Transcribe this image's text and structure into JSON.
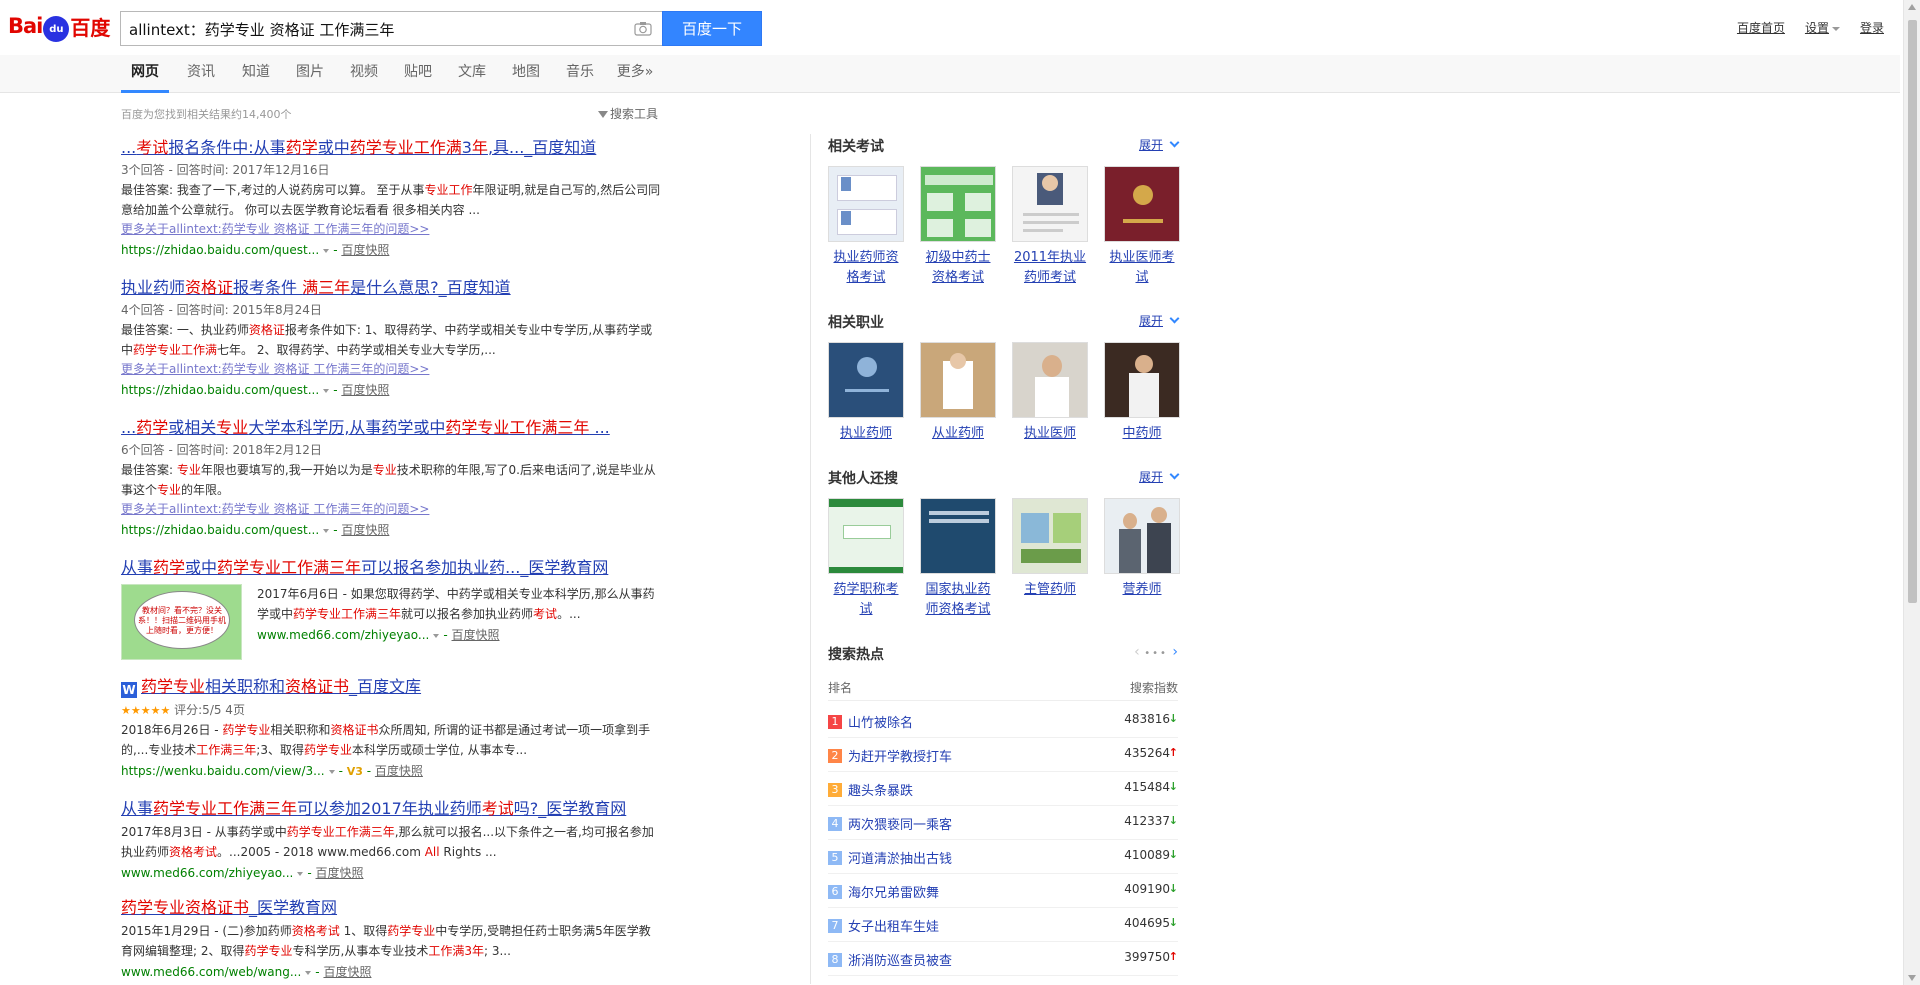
{
  "logo": {
    "part1": "Bai",
    "paw": "du",
    "part2": "百度"
  },
  "search": {
    "query": "allintext：药学专业 资格证 工作满三年",
    "button": "百度一下"
  },
  "user_links": {
    "home": "百度首页",
    "settings": "设置",
    "login": "登录"
  },
  "tabs": [
    "网页",
    "资讯",
    "知道",
    "图片",
    "视频",
    "贴吧",
    "文库",
    "地图",
    "音乐",
    "更多»"
  ],
  "result_count": "百度为您找到相关结果约14,400个",
  "search_tools": "搜索工具",
  "results": [
    {
      "title": [
        [
          "...",
          false
        ],
        [
          "考试",
          true
        ],
        [
          "报名条件中:从事",
          false
        ],
        [
          "药学",
          true
        ],
        [
          "或中",
          false
        ],
        [
          "药学专业工作满",
          true
        ],
        [
          "3",
          false
        ],
        [
          "年",
          true
        ],
        [
          ",具..._百度知道",
          false
        ]
      ],
      "meta": "3个回答 - 回答时间: 2017年12月16日",
      "abstract": [
        [
          "最佳答案: 我查了一下,考过的人说药房可以算。 至于从事",
          false
        ],
        [
          "专业工作",
          true
        ],
        [
          "年限证明,就是自己写的,然后公司同意给加盖个公章就行。 你可以去医学教育论坛看看 很多相关内容 ...",
          false
        ]
      ],
      "more": "更多关于allintext:药学专业 资格证 工作满三年的问题>>",
      "url": "https://zhidao.baidu.com/quest...",
      "cache": "百度快照"
    },
    {
      "title": [
        [
          "执业药师",
          false
        ],
        [
          "资格证",
          true
        ],
        [
          "报考条件 ",
          false
        ],
        [
          "满三年",
          true
        ],
        [
          "是什么意思?_百度知道",
          false
        ]
      ],
      "meta": "4个回答 - 回答时间: 2015年8月24日",
      "abstract": [
        [
          "最佳答案: 一、执业药师",
          false
        ],
        [
          "资格证",
          true
        ],
        [
          "报考条件如下: 1、取得药学、中药学或相关专业中专学历,从事药学或中",
          false
        ],
        [
          "药学专业工作满",
          true
        ],
        [
          "七年。 2、取得药学、中药学或相关专业大专学历,...",
          false
        ]
      ],
      "more": "更多关于allintext:药学专业 资格证 工作满三年的问题>>",
      "url": "https://zhidao.baidu.com/quest...",
      "cache": "百度快照"
    },
    {
      "title": [
        [
          "...",
          false
        ],
        [
          "药学",
          true
        ],
        [
          "或相关",
          false
        ],
        [
          "专业",
          true
        ],
        [
          "大学本科学历,从事药学或中",
          false
        ],
        [
          "药学专业工作满三年",
          true
        ],
        [
          " ...",
          false
        ]
      ],
      "meta": "6个回答 - 回答时间: 2018年2月12日",
      "abstract": [
        [
          "最佳答案: ",
          false
        ],
        [
          "专业",
          true
        ],
        [
          "年限也要填写的,我一开始以为是",
          false
        ],
        [
          "专业",
          true
        ],
        [
          "技术职称的年限,写了0.后来电话问了,说是毕业从事这个",
          false
        ],
        [
          "专业",
          true
        ],
        [
          "的年限。",
          false
        ]
      ],
      "more": "更多关于allintext:药学专业 资格证 工作满三年的问题>>",
      "url": "https://zhidao.baidu.com/quest...",
      "cache": "百度快照"
    },
    {
      "title": [
        [
          "从事",
          false
        ],
        [
          "药学",
          true
        ],
        [
          "或中",
          false
        ],
        [
          "药学专业工作满三年",
          true
        ],
        [
          "可以报名参加执业药..._医学教育网",
          false
        ]
      ],
      "thumb_text": "教材间？看不完？没关系！！扫描二维码用手机上随时看，更方便！",
      "abstract": [
        [
          "2017年6月6日 - 如果您取得药学、中药学或相关专业本科学历,那么从事药学或中",
          false
        ],
        [
          "药学专业工作满三年",
          true
        ],
        [
          "就可以报名参加执业药师",
          false
        ],
        [
          "考试",
          true
        ],
        [
          "。...",
          false
        ]
      ],
      "url": "www.med66.com/zhiyeyao...",
      "cache": "百度快照"
    },
    {
      "title": [
        [
          "药学专业",
          true
        ],
        [
          "相关职称和",
          false
        ],
        [
          "资格证书",
          true
        ],
        [
          "_百度文库",
          false
        ]
      ],
      "doc_icon": "W",
      "rating": "★★★★★",
      "rating_text": "评分:5/5 4页",
      "abstract": [
        [
          "2018年6月26日 - ",
          false
        ],
        [
          "药学专业",
          true
        ],
        [
          "相关职称和",
          false
        ],
        [
          "资格证书",
          true
        ],
        [
          "众所周知, 所谓的证书都是通过考试一项一项拿到手的,...专业技术",
          false
        ],
        [
          "工作满三年",
          true
        ],
        [
          ";3、取得",
          false
        ],
        [
          "药学专业",
          true
        ],
        [
          "本科学历或硕士学位, 从事本专...",
          false
        ]
      ],
      "url": "https://wenku.baidu.com/view/3...",
      "v_badge": "V3",
      "cache": "百度快照"
    },
    {
      "title": [
        [
          "从事",
          false
        ],
        [
          "药学专业工作满三年",
          true
        ],
        [
          "可以参加2017年执业药师",
          false
        ],
        [
          "考试",
          true
        ],
        [
          "吗?_医学教育网",
          false
        ]
      ],
      "abstract": [
        [
          "2017年8月3日 - 从事药学或中",
          false
        ],
        [
          "药学专业工作满三年",
          true
        ],
        [
          ",那么就可以报名...以下条件之一者,均可报名参加执业药师",
          false
        ],
        [
          "资格考试",
          true
        ],
        [
          "。...2005 - 2018 www.med66.com ",
          false
        ],
        [
          "All",
          true
        ],
        [
          " Rights ...",
          false
        ]
      ],
      "url": "www.med66.com/zhiyeyao...",
      "cache": "百度快照"
    },
    {
      "title": [
        [
          "药学专业资格证书",
          true
        ],
        [
          "_医学教育网",
          false
        ]
      ],
      "abstract": [
        [
          "2015年1月29日 - (二)参加药师",
          false
        ],
        [
          "资格考试",
          true
        ],
        [
          " 1、取得",
          false
        ],
        [
          "药学专业",
          true
        ],
        [
          "中专学历,受聘担任药士职务满5年医学教育网编辑整理; 2、取得",
          false
        ],
        [
          "药学专业",
          true
        ],
        [
          "专科学历,从事本专业技术",
          false
        ],
        [
          "工作满3年",
          true
        ],
        [
          "; 3...",
          false
        ]
      ],
      "url": "www.med66.com/web/wang...",
      "cache": "百度快照"
    }
  ],
  "sidebar": {
    "expand": "展开",
    "related_exams": {
      "title": "相关考试",
      "items": [
        "执业药师资格考试",
        "初级中药士资格考试",
        "2011年执业药师考试",
        "执业医师考试"
      ]
    },
    "related_jobs": {
      "title": "相关职业",
      "items": [
        "执业药师",
        "从业药师",
        "执业医师",
        "中药师"
      ]
    },
    "others_search": {
      "title": "其他人还搜",
      "items": [
        "药学职称考试",
        "国家执业药师资格考试",
        "主管药师",
        "营养师"
      ]
    },
    "hot": {
      "title": "搜索热点",
      "col_rank": "排名",
      "col_index": "搜索指数",
      "rows": [
        {
          "rank": "1",
          "word": "山竹被除名",
          "index": "483816",
          "trend": "down"
        },
        {
          "rank": "2",
          "word": "为赶开学教授打车",
          "index": "435264",
          "trend": "up"
        },
        {
          "rank": "3",
          "word": "趣头条暴跌",
          "index": "415484",
          "trend": "down"
        },
        {
          "rank": "4",
          "word": "两次猥亵同一乘客",
          "index": "412337",
          "trend": "down"
        },
        {
          "rank": "5",
          "word": "河道清淤抽出古钱",
          "index": "410089",
          "trend": "down"
        },
        {
          "rank": "6",
          "word": "海尔兄弟雷欧舞",
          "index": "409190",
          "trend": "down"
        },
        {
          "rank": "7",
          "word": "女子出租车生娃",
          "index": "404695",
          "trend": "down"
        },
        {
          "rank": "8",
          "word": "浙消防巡查员被查",
          "index": "399750",
          "trend": "up"
        }
      ]
    }
  },
  "colors": {
    "accent": "#3385ff",
    "link": "#2440b3",
    "highlight": "#e10601",
    "url": "#008000",
    "rank_top": [
      "#f54545",
      "#ff8547",
      "#ffac38"
    ],
    "rank_rest": "#8eb9f5",
    "up": "#e10601",
    "down": "#2ca02c"
  }
}
